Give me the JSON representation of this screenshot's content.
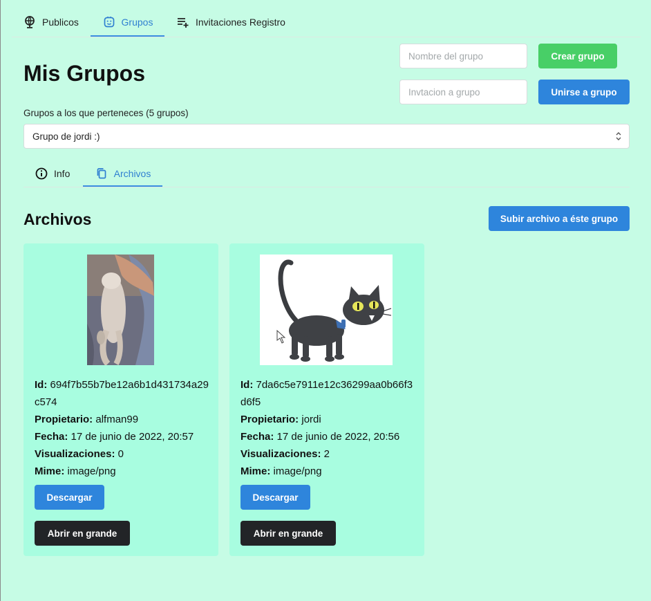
{
  "nav": {
    "tabs": [
      {
        "label": "Publicos",
        "icon": "globe-icon",
        "active": false
      },
      {
        "label": "Grupos",
        "icon": "group-face-icon",
        "active": true
      },
      {
        "label": "Invitaciones Registro",
        "icon": "playlist-add-icon",
        "active": false
      }
    ]
  },
  "header": {
    "title": "Mis Grupos",
    "group_name_placeholder": "Nombre del grupo",
    "create_label": "Crear grupo",
    "invite_placeholder": "Invtacion a grupo",
    "join_label": "Unirse a grupo"
  },
  "groups": {
    "label": "Grupos a los que perteneces (5 grupos)",
    "selected": "Grupo de jordi :)"
  },
  "subtabs": [
    {
      "label": "Info",
      "icon": "info-icon",
      "active": false
    },
    {
      "label": "Archivos",
      "icon": "copy-files-icon",
      "active": true
    }
  ],
  "files_section": {
    "title": "Archivos",
    "upload_label": "Subir archivo a éste grupo"
  },
  "field_labels": {
    "id": "Id:",
    "owner": "Propietario:",
    "date": "Fecha:",
    "views": "Visualizaciones:",
    "mime": "Mime:"
  },
  "files": [
    {
      "id": "694f7b55b7be12a6b1d431734a29c574",
      "owner": "alfman99",
      "date": "17 de junio de 2022, 20:57",
      "views": "0",
      "mime": "image/png",
      "download_label": "Descargar",
      "open_label": "Abrir en grande",
      "thumbnail": "kitten-photo"
    },
    {
      "id": "7da6c5e7911e12c36299aa0b66f3d6f5",
      "owner": "jordi",
      "date": "17 de junio de 2022, 20:56",
      "views": "2",
      "mime": "image/png",
      "download_label": "Descargar",
      "open_label": "Abrir en grande",
      "thumbnail": "cartoon-black-cat"
    }
  ],
  "colors": {
    "background": "#c6fce5",
    "card": "#a8fde0",
    "accent_blue": "#2e85dc",
    "accent_green": "#48cf67",
    "dark_button": "#222427"
  }
}
